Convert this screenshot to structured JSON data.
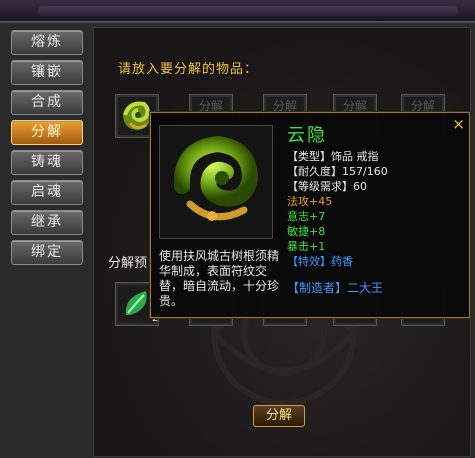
{
  "sidebar": {
    "items": [
      {
        "label": "熔炼"
      },
      {
        "label": "镶嵌"
      },
      {
        "label": "合成"
      },
      {
        "label": "分解"
      },
      {
        "label": "铸魂"
      },
      {
        "label": "启魂"
      },
      {
        "label": "继承"
      },
      {
        "label": "绑定"
      }
    ]
  },
  "main": {
    "prompt": "请放入要分解的物品：",
    "slot_label": "分解",
    "preview_label": "分解预",
    "result_count": "2",
    "decompose_button": "分解"
  },
  "tooltip": {
    "name": "云隐",
    "type": "【类型】饰品  戒指",
    "durability": "【耐久度】157/160",
    "level_req": "【等级需求】60",
    "stat_attack": "法攻+45",
    "stat_will": "意志+7",
    "stat_agility": "敏捷+8",
    "stat_crit": "暴击+1",
    "special": "【特效】药香",
    "description": "使用扶风城古树根须精华制成，表面符纹交替，暗自流动，十分珍贵。",
    "maker": "【制造者】二大王",
    "close": "×"
  },
  "colors": {
    "name": "#3ee23e",
    "stat": "#f0a020",
    "green_stat": "#3ee23e",
    "special": "#3a9cff",
    "active_tab": "#f0a030"
  },
  "icons": {
    "item": "green-jade-ring-icon",
    "material": "green-leaf-icon"
  }
}
